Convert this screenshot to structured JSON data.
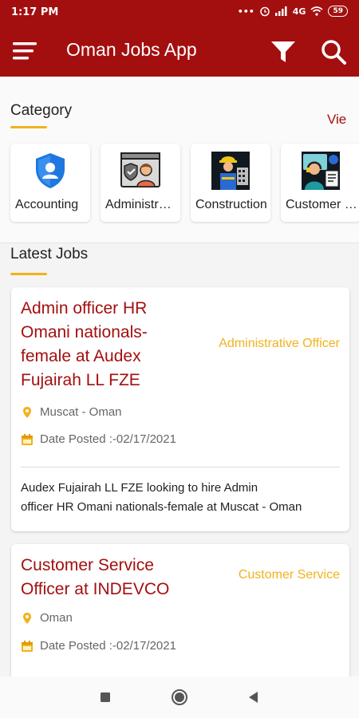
{
  "status_bar": {
    "time": "1:17 PM",
    "network": "4G",
    "battery": "59"
  },
  "app_bar": {
    "title": "Oman Jobs App",
    "menu_icon": "hamburger-menu-icon",
    "filter_icon": "filter-icon",
    "search_icon": "search-icon"
  },
  "category_section": {
    "title": "Category",
    "view_all": "Vie",
    "items": [
      {
        "label": "Accounting",
        "icon": "shield-user-icon"
      },
      {
        "label": "Administration",
        "icon": "admin-worker-icon"
      },
      {
        "label": "Construction",
        "icon": "construction-worker-icon"
      },
      {
        "label": "Customer Service",
        "icon": "customer-service-icon"
      }
    ]
  },
  "latest_section": {
    "title": "Latest Jobs",
    "jobs": [
      {
        "title": "Admin officer HR Omani nationals-female at Audex Fujairah LL FZE",
        "category": "Administrative Officer",
        "location": "Muscat - Oman",
        "date_posted": "Date Posted :-02/17/2021",
        "description_line1": "Audex Fujairah LL FZE looking to hire Admin",
        "description_line2": "officer HR Omani nationals-female at Muscat - Oman"
      },
      {
        "title": "Customer Service Officer at INDEVCO",
        "category": "Customer Service",
        "location": "Oman",
        "date_posted": "Date Posted :-02/17/2021"
      }
    ]
  },
  "colors": {
    "primary": "#a30f0f",
    "accent": "#f2b21c"
  },
  "nav_bar": {
    "recents_icon": "recents-square-icon",
    "home_icon": "home-circle-icon",
    "back_icon": "back-triangle-icon"
  }
}
